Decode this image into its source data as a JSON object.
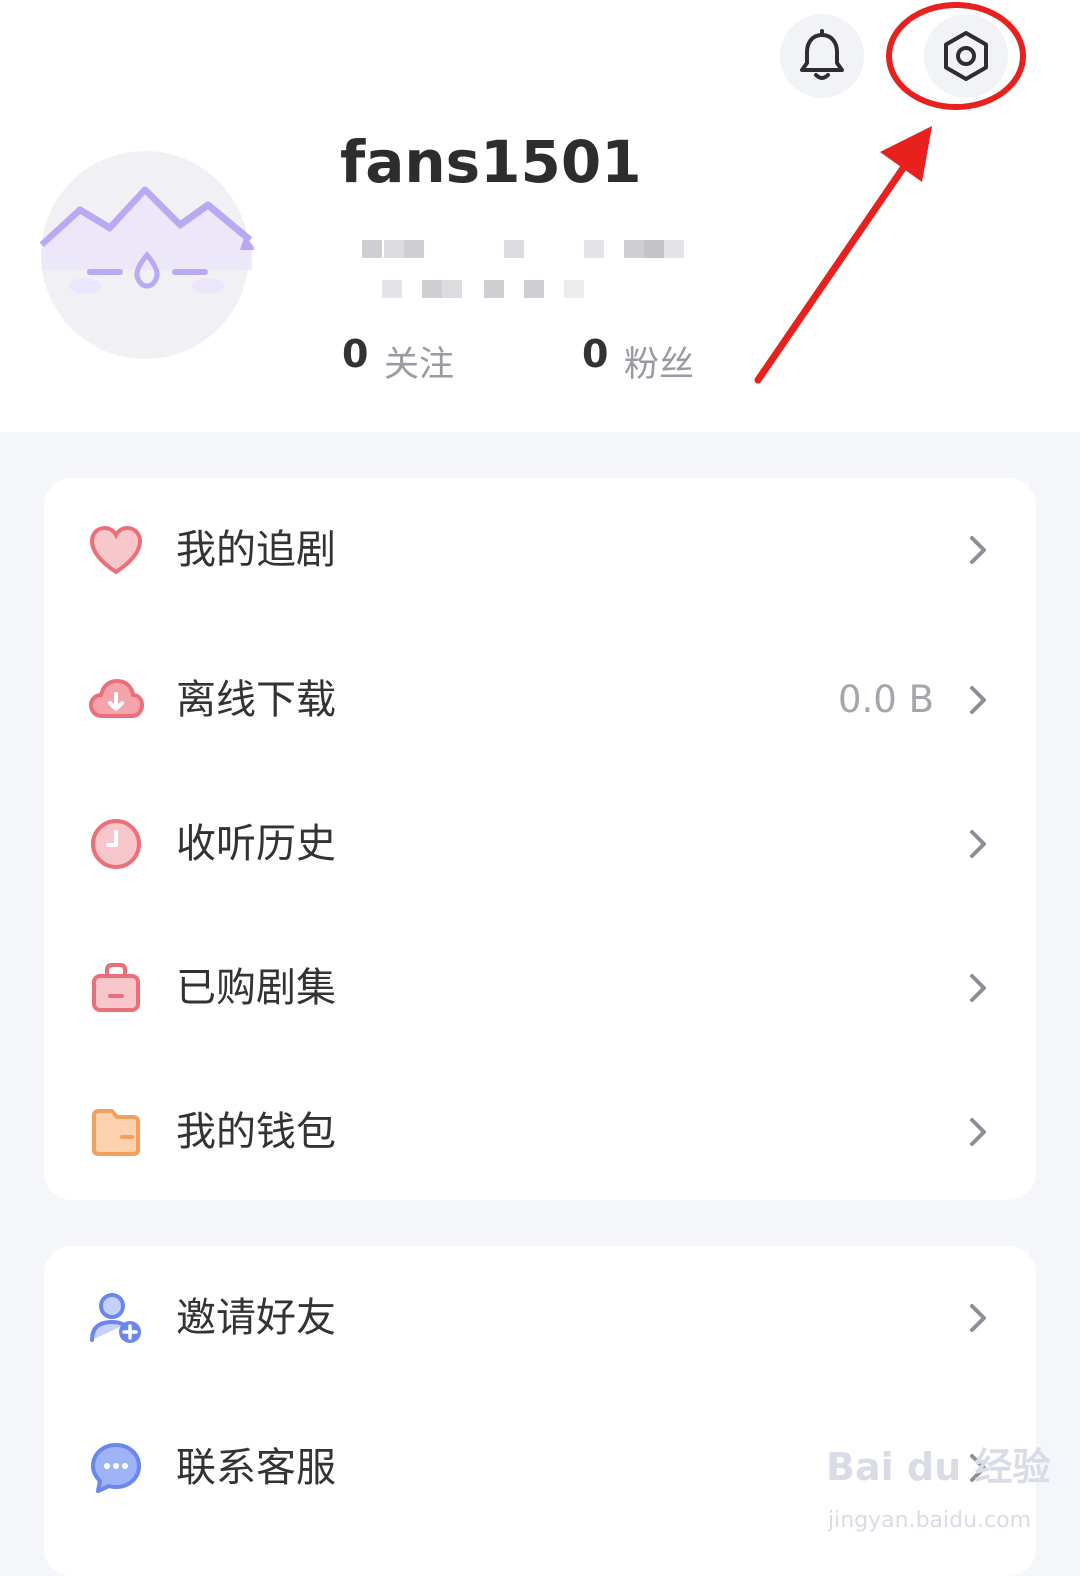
{
  "profile": {
    "username": "fans1501",
    "following_count": "0",
    "following_label": "关注",
    "fans_count": "0",
    "fans_label": "粉丝"
  },
  "menu_main": [
    {
      "label": "我的追剧",
      "icon": "heart-icon",
      "value": ""
    },
    {
      "label": "离线下载",
      "icon": "cloud-download-icon",
      "value": "0.0 B"
    },
    {
      "label": "收听历史",
      "icon": "clock-icon",
      "value": ""
    },
    {
      "label": "已购剧集",
      "icon": "shopping-bag-icon",
      "value": ""
    },
    {
      "label": "我的钱包",
      "icon": "wallet-icon",
      "value": ""
    }
  ],
  "menu_secondary": [
    {
      "label": "邀请好友",
      "icon": "add-user-icon"
    },
    {
      "label": "联系客服",
      "icon": "chat-bubble-icon"
    }
  ],
  "watermark": {
    "brand": "Bai du 经验",
    "url": "jingyan.baidu.com"
  },
  "colors": {
    "accent_red": "#ec6e78",
    "annotation_red": "#e8211e",
    "avatar_purple": "#b9a8f2"
  }
}
